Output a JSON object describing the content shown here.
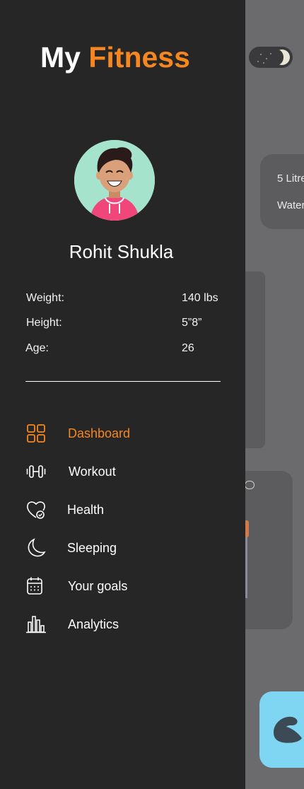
{
  "app": {
    "title_part1": "My",
    "title_part2": "Fitness",
    "accent_color": "#f6861f"
  },
  "profile": {
    "name": "Rohit Shukla",
    "avatar_icon": "avatar-icon",
    "stats": [
      {
        "label": "Weight:",
        "value": "140 lbs"
      },
      {
        "label": "Height:",
        "value": "5”8”"
      },
      {
        "label": "Age:",
        "value": "26"
      }
    ]
  },
  "nav": {
    "items": [
      {
        "label": "Dashboard",
        "icon": "grid-icon",
        "active": true
      },
      {
        "label": "Workout",
        "icon": "dumbbell-icon",
        "active": false
      },
      {
        "label": "Health",
        "icon": "heart-check-icon",
        "active": false
      },
      {
        "label": "Sleeping",
        "icon": "moon-icon",
        "active": false
      },
      {
        "label": "Your goals",
        "icon": "calendar-icon",
        "active": false
      },
      {
        "label": "Analytics",
        "icon": "bar-chart-icon",
        "active": false
      }
    ]
  },
  "background": {
    "water_card": {
      "line1": "5 Litre",
      "line2": "Water"
    },
    "theme_toggle_icon": "moon-toggle-icon",
    "blue_card_icon": "muscle-icon"
  }
}
